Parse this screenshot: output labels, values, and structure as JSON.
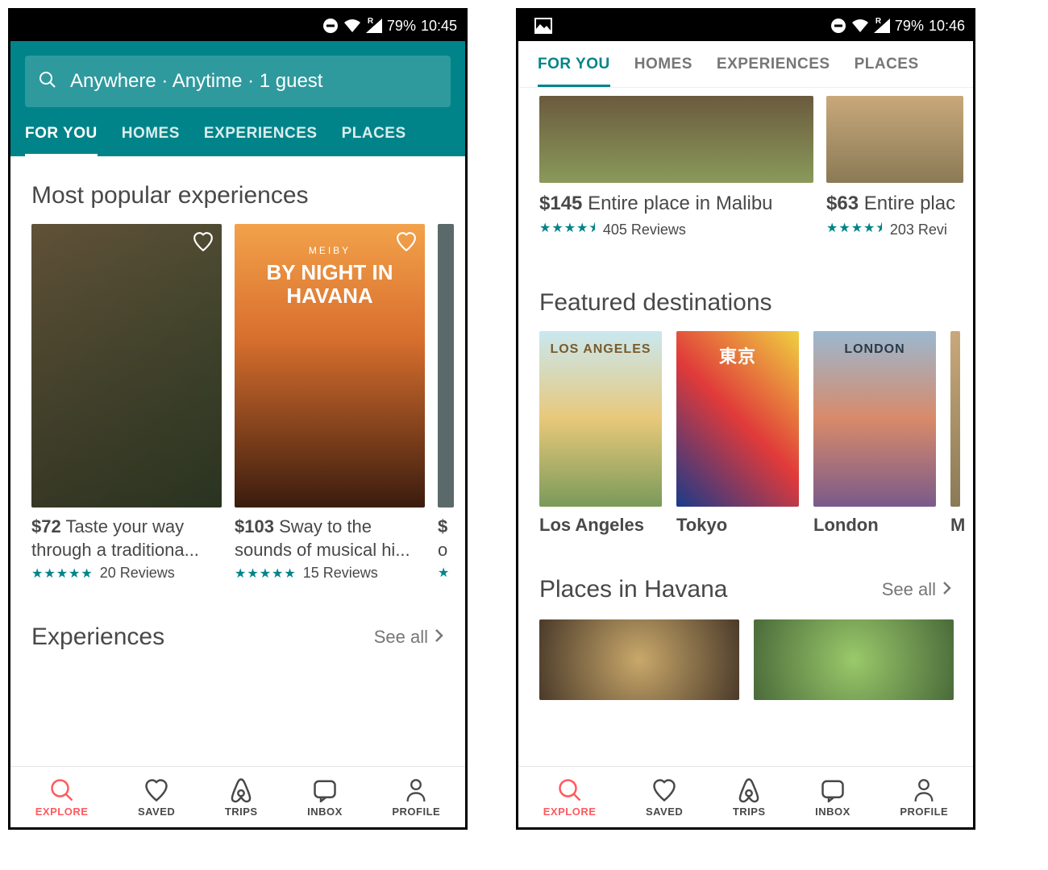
{
  "left": {
    "status": {
      "battery": "79%",
      "time": "10:45",
      "roaming": "R"
    },
    "search": {
      "text": "Anywhere · Anytime · 1 guest"
    },
    "tabs": [
      "FOR YOU",
      "HOMES",
      "EXPERIENCES",
      "PLACES"
    ],
    "active_tab": 0,
    "section1_title": "Most popular experiences",
    "cards": [
      {
        "price": "$72",
        "title": "Taste your way through a traditiona...",
        "reviews": "20 Reviews",
        "rating": 5
      },
      {
        "price": "$103",
        "title": "Sway to the sounds of musical hi...",
        "reviews": "15 Reviews",
        "rating": 5,
        "overlay_sub": "MEIBY",
        "overlay_main": "BY NIGHT IN<br>HAVANA"
      },
      {
        "price": "$",
        "title": "o",
        "reviews": "",
        "rating": 5
      }
    ],
    "section2_title": "Experiences",
    "see_all": "See all"
  },
  "right": {
    "status": {
      "battery": "79%",
      "time": "10:46",
      "roaming": "R"
    },
    "tabs": [
      "FOR YOU",
      "HOMES",
      "EXPERIENCES",
      "PLACES"
    ],
    "active_tab": 0,
    "listings": [
      {
        "price": "$145",
        "title": "Entire place in Malibu",
        "reviews": "405 Reviews",
        "rating": 4.5
      },
      {
        "price": "$63",
        "title": "Entire plac",
        "reviews": "203 Revi",
        "rating": 4.5
      }
    ],
    "dest_title": "Featured destinations",
    "destinations": [
      {
        "label": "LOS ANGELES",
        "name": "Los Angeles",
        "bg": "bg-la"
      },
      {
        "label": "東京",
        "name": "Tokyo",
        "bg": "bg-tokyo"
      },
      {
        "label": "LONDON",
        "name": "London",
        "bg": "bg-london"
      },
      {
        "label": "",
        "name": "M",
        "bg": "bg-p2"
      }
    ],
    "places_title": "Places in Havana",
    "see_all": "See all"
  },
  "bottom_nav": [
    "EXPLORE",
    "SAVED",
    "TRIPS",
    "INBOX",
    "PROFILE"
  ],
  "active_nav": 0,
  "colors": {
    "teal": "#008489",
    "coral": "#FF5A5F"
  }
}
